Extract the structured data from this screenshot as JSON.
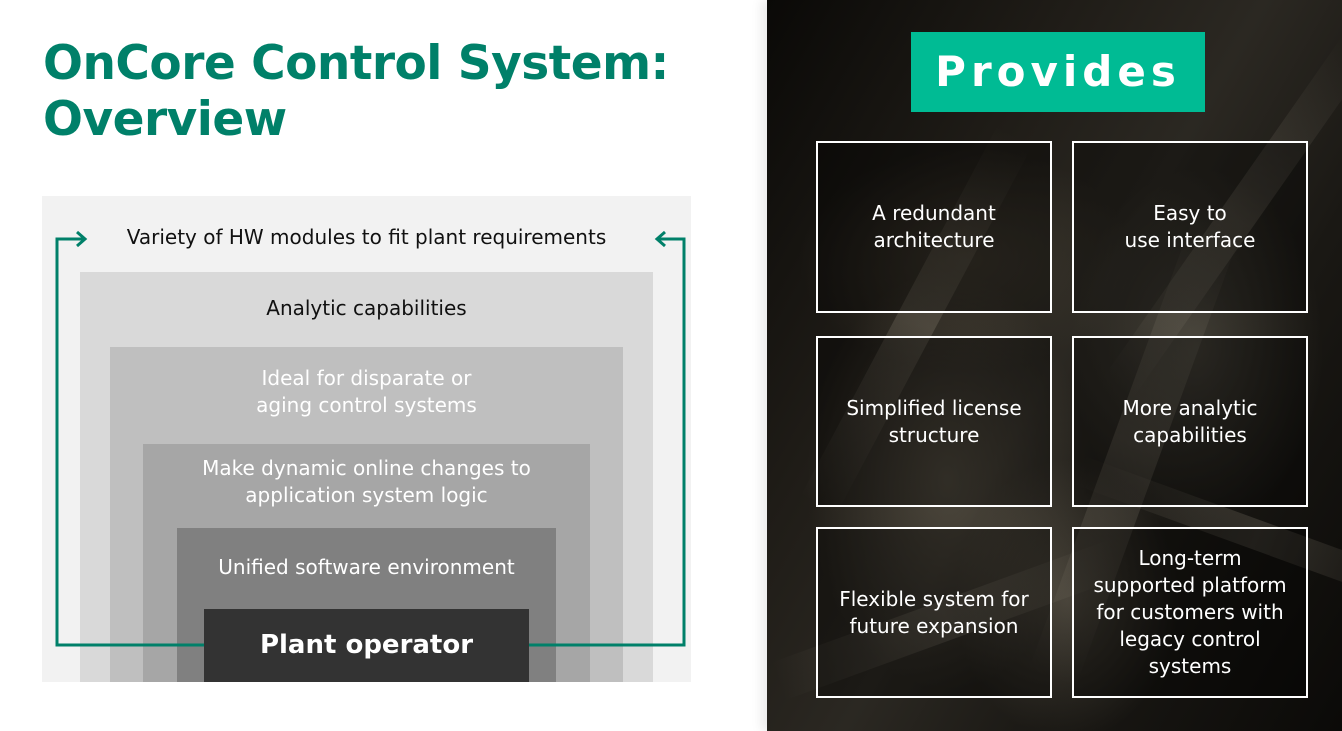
{
  "title": "OnCore Control System:\nOverview",
  "diagram": {
    "layers": [
      {
        "label": "Variety of HW modules to fit plant requirements",
        "color": "#f2f2f2"
      },
      {
        "label": "Analytic capabilities",
        "color": "#d9d9d9"
      },
      {
        "label": "Ideal for disparate or\naging control systems",
        "color": "#bfbfbf"
      },
      {
        "label": "Make dynamic online changes to\napplication system logic",
        "color": "#a6a6a6"
      },
      {
        "label": "Unified software environment",
        "color": "#808080"
      },
      {
        "label": "Plant operator",
        "color": "#333333"
      }
    ],
    "loop_color": "#008069"
  },
  "provides": {
    "heading": "Provides",
    "accent": "#00bb94",
    "items": [
      {
        "label": "A redundant\narchitecture"
      },
      {
        "label": "Easy to\nuse interface"
      },
      {
        "label": "Simplified license\nstructure"
      },
      {
        "label": "More analytic\ncapabilities"
      },
      {
        "label": "Flexible system for\nfuture expansion"
      },
      {
        "label": "Long-term\nsupported platform\nfor customers with\nlegacy control\nsystems"
      }
    ]
  }
}
